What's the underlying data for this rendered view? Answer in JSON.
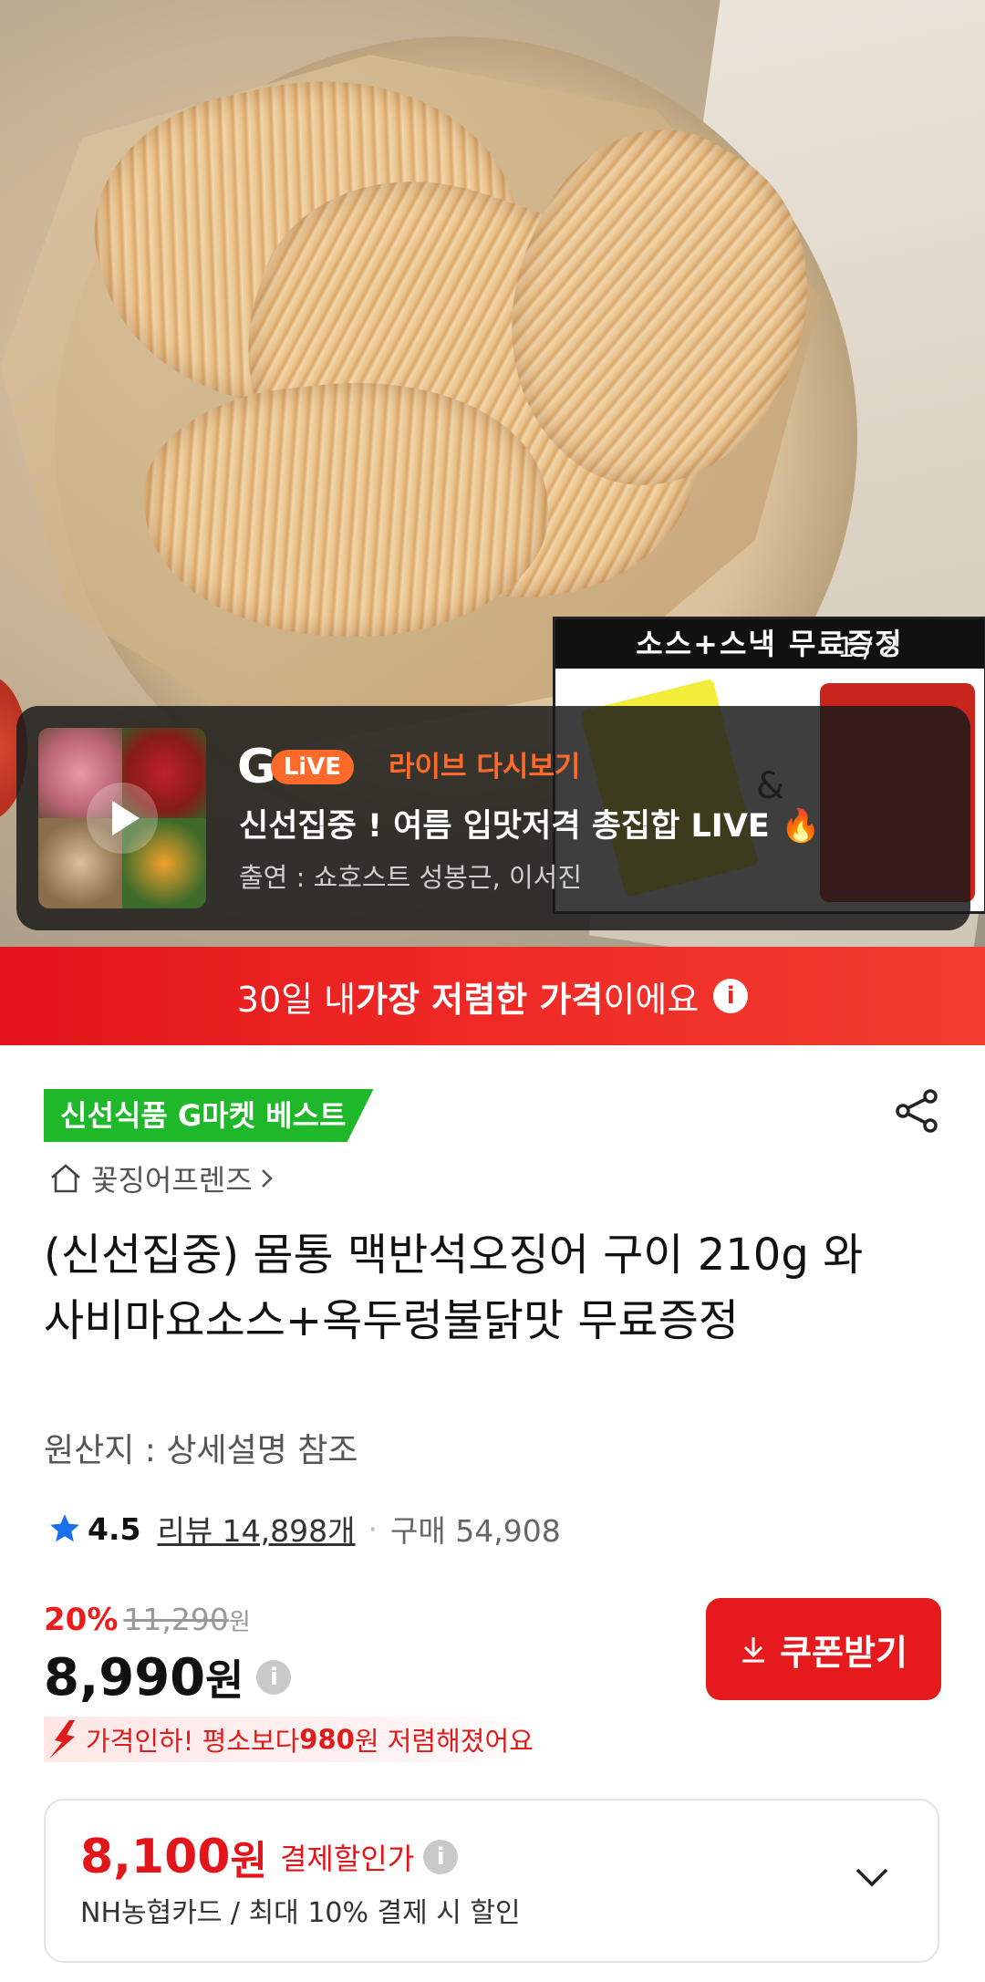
{
  "hero": {
    "counter": "1 / 2",
    "promo_header": "소스+스낵 무료증정"
  },
  "live": {
    "logo_g": "G",
    "logo_pill": "LiVE",
    "replay_label": "라이브 다시보기",
    "title": "신선집중 ! 여름 입맛저격 총집합 LIVE 🔥",
    "cast": "출연 : 쇼호스트 성봉근, 이서진"
  },
  "banner": {
    "text_prefix": "30일 내 ",
    "text_strong": "가장 저렴한 가격",
    "text_suffix": "이에요"
  },
  "product": {
    "badge": "신선식품 G마켓 베스트",
    "seller": "꽃징어프렌즈",
    "title": "(신선집중) 몸통 맥반석오징어 구이 210g 와사비마요소스+옥두렁불닭맛 무료증정",
    "origin": "원산지 : 상세설명 참조",
    "rating": "4.5",
    "review_label": "리뷰 14,898개",
    "sales_label": "구매 54,908",
    "discount_pct": "20%",
    "original_price": "11,290",
    "original_won": "원",
    "price": "8,990",
    "price_won": "원",
    "coupon_button": "쿠폰받기",
    "price_drop_prefix": "가격인하! 평소보다 ",
    "price_drop_amount": "980",
    "price_drop_suffix": "원 저렴해졌어요"
  },
  "payment": {
    "amount": "8,100",
    "won": "원",
    "label": "결제할인가",
    "detail": "NH농협카드 / 최대 10% 결제 시 할인"
  },
  "colors": {
    "accent_red": "#e3141a",
    "best_green": "#1fb82a",
    "live_orange": "#ff6a2b",
    "rating_star": "#1a6ff0"
  }
}
